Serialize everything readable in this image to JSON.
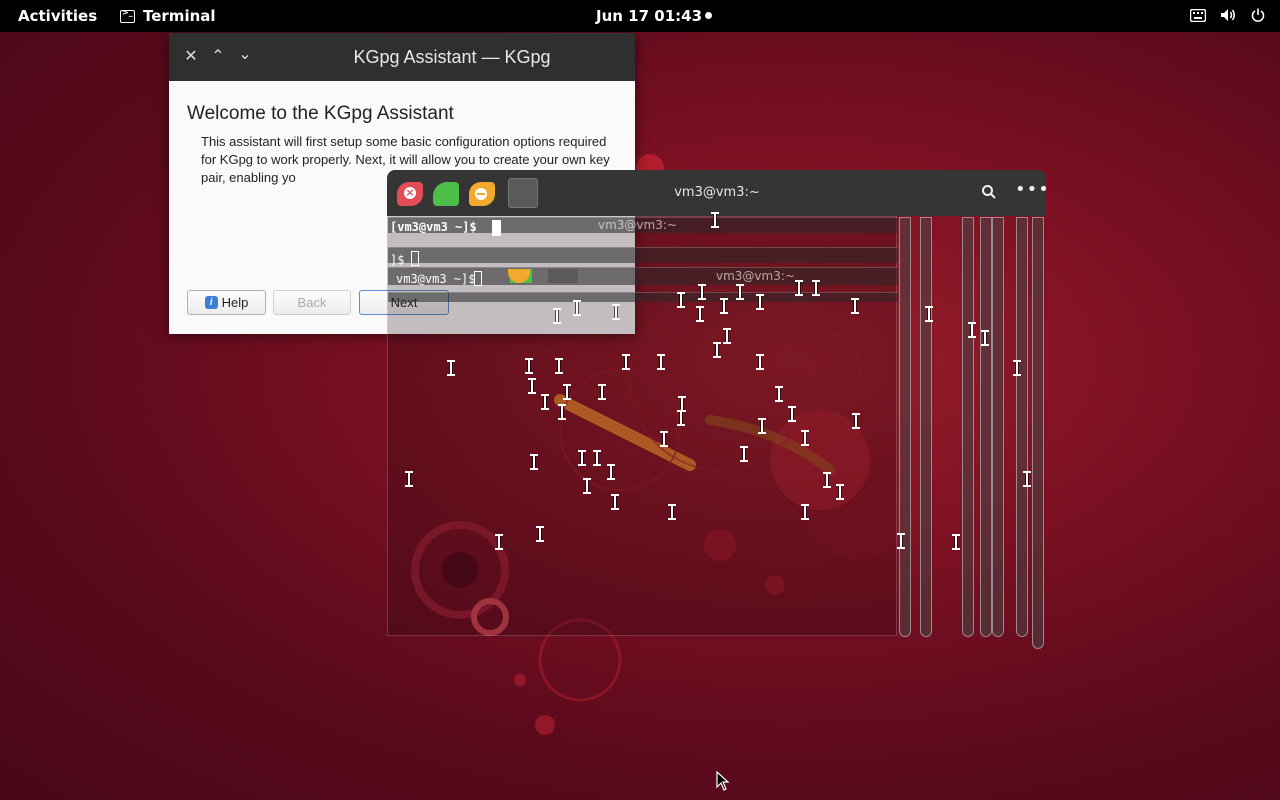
{
  "topbar": {
    "activities": "Activities",
    "app_name": "Terminal",
    "clock": "Jun 17  01:43",
    "tray_icons": [
      "keyboard-icon",
      "volume-icon",
      "power-icon"
    ]
  },
  "kgpg": {
    "window_title": "KGpg Assistant — KGpg",
    "heading": "Welcome to the KGpg Assistant",
    "body_text": "This assistant will first setup some basic configuration options required for KGpg to work properly. Next, it will allow you to create your own key pair, enabling yo",
    "buttons": {
      "help": "Help",
      "back": "Back",
      "next": "Next"
    }
  },
  "terminal": {
    "title": "vm3@vm3:~",
    "prompt_main": "[vm3@vm3 ~]$",
    "prompt_short": "]$",
    "prompt_ghost": "vm3@vm3 ~]$",
    "ghost_title": "vm3@vm3:~"
  },
  "colors": {
    "topbar_bg": "#000000",
    "terminal_header": "#353535",
    "close_red": "#e24d58",
    "max_green": "#4ec04a",
    "min_orange": "#f3a92b",
    "wallpaper": "#7a1022"
  }
}
